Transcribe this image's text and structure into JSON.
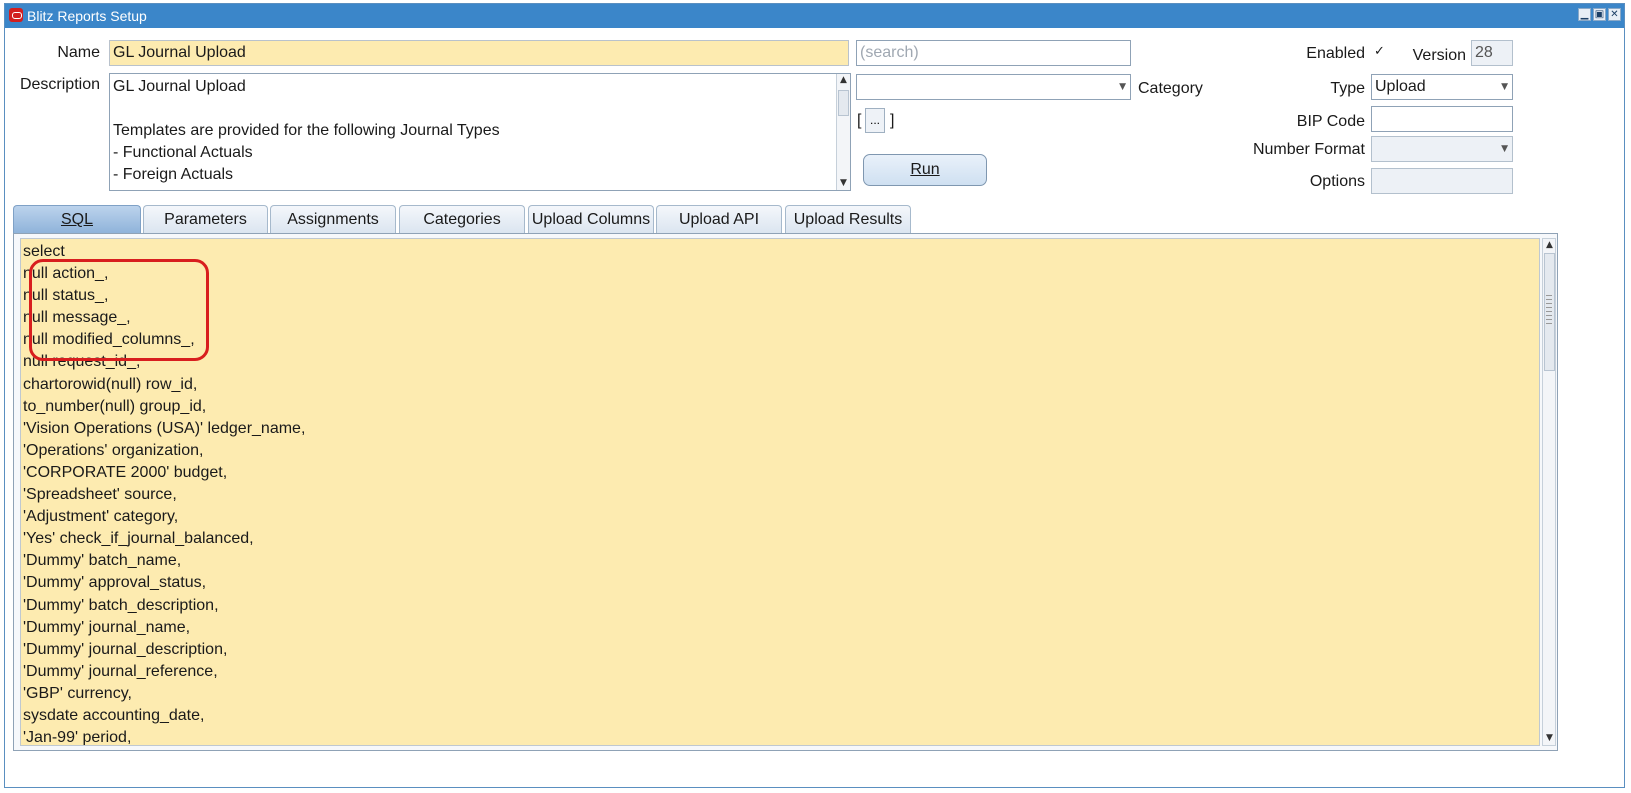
{
  "window": {
    "title": "Blitz Reports Setup",
    "controls": [
      "minimize-icon",
      "restore-icon",
      "close-icon"
    ]
  },
  "form": {
    "name_label": "Name",
    "name_value": "GL Journal Upload",
    "search_placeholder": "(search)",
    "description_label": "Description",
    "description_text": "GL Journal Upload\n\nTemplates are provided for the following Journal Types\n- Functional Actuals\n- Foreign Actuals",
    "category_label": "Category",
    "category_value": "",
    "lov_bracket_open": "[",
    "lov_button": "...",
    "lov_bracket_close": "]",
    "run_label": "Run",
    "enabled_label": "Enabled",
    "enabled_checked": true,
    "enabled_mark": "✓",
    "version_label": "Version",
    "version_value": "28",
    "type_label": "Type",
    "type_value": "Upload",
    "bip_code_label": "BIP Code",
    "bip_code_value": "",
    "number_format_label": "Number Format",
    "number_format_value": "",
    "options_label": "Options",
    "options_value": ""
  },
  "tabs": [
    {
      "label": "SQL",
      "active": true
    },
    {
      "label": "Parameters",
      "active": false
    },
    {
      "label": "Assignments",
      "active": false
    },
    {
      "label": "Categories",
      "active": false
    },
    {
      "label": "Upload Columns",
      "active": false
    },
    {
      "label": "Upload API",
      "active": false
    },
    {
      "label": "Upload Results",
      "active": false
    }
  ],
  "sql_lines": [
    "select",
    "null action_,",
    "null status_,",
    "null message_,",
    "null modified_columns_,",
    "null request_id_,",
    "chartorowid(null) row_id,",
    "to_number(null) group_id,",
    "'Vision Operations (USA)' ledger_name,",
    "'Operations' organization,",
    "'CORPORATE 2000' budget,",
    "'Spreadsheet' source,",
    "'Adjustment' category,",
    "'Yes' check_if_journal_balanced,",
    "'Dummy' batch_name,",
    "'Dummy' approval_status,",
    "'Dummy' batch_description,",
    "'Dummy' journal_name,",
    "'Dummy' journal_description,",
    "'Dummy' journal_reference,",
    "'GBP' currency,",
    "sysdate accounting_date,",
    "'Jan-99' period,"
  ],
  "colors": {
    "titlebar": "#3b86c9",
    "field_highlight": "#fdebb0",
    "annotation_box": "#d81e1e"
  }
}
